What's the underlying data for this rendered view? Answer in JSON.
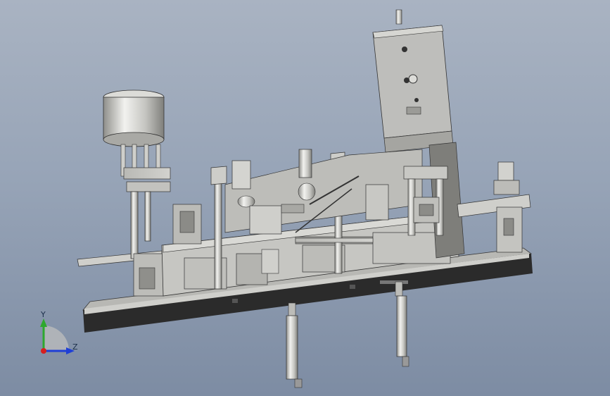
{
  "viewport": {
    "background_top": "#a9b3c2",
    "background_bottom": "#7d8ca3"
  },
  "model": {
    "description_visible": false,
    "palette": {
      "body": "#c9c9c5",
      "shade": "#9e9e9a",
      "dark": "#2b2b2b",
      "line": "#3a3a3a",
      "highlight": "#f0f0ee"
    }
  },
  "triad": {
    "y_label": "Y",
    "z_label": "Z",
    "y_color": "#2ea82e",
    "z_color": "#1f3fd6",
    "x_color": "#d61f1f"
  }
}
